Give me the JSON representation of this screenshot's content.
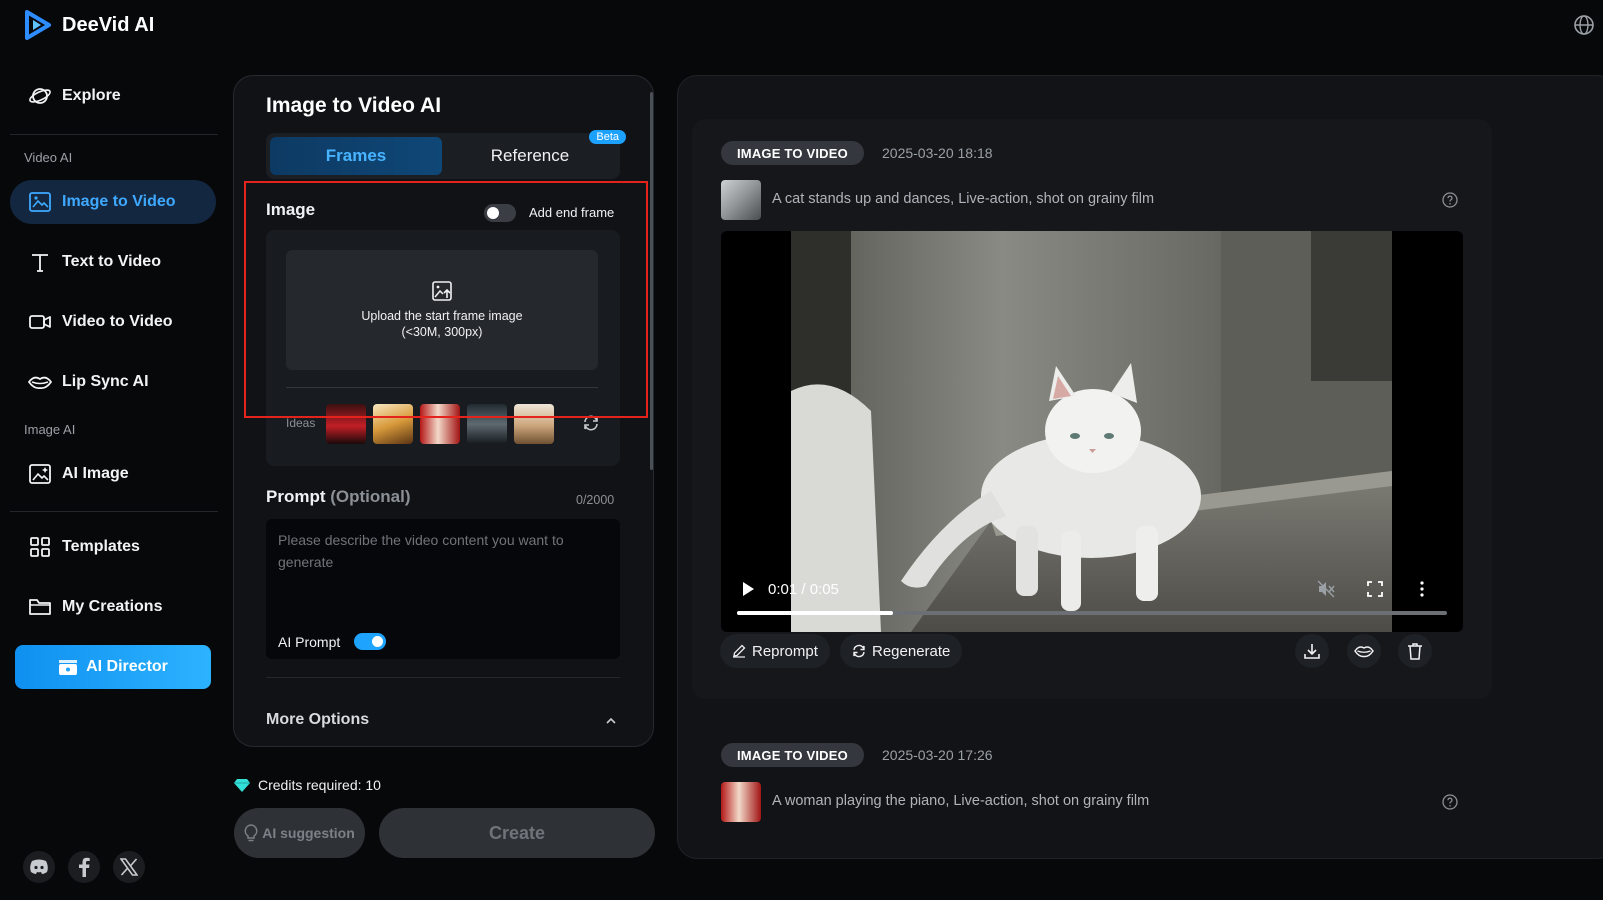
{
  "brand": {
    "name": "DeeVid AI"
  },
  "nav": {
    "explore": "Explore",
    "section_video": "Video AI",
    "image_to_video": "Image to Video",
    "text_to_video": "Text to Video",
    "video_to_video": "Video to Video",
    "lip_sync": "Lip Sync AI",
    "section_image": "Image AI",
    "ai_image": "AI Image",
    "templates": "Templates",
    "my_creations": "My Creations",
    "ai_director": "AI Director"
  },
  "form": {
    "title": "Image to Video AI",
    "tabs": {
      "frames": "Frames",
      "reference": "Reference",
      "beta": "Beta"
    },
    "image_label": "Image",
    "end_frame_label": "Add end frame",
    "upload_line1": "Upload the start frame image",
    "upload_line2": "(<30M, 300px)",
    "ideas_label": "Ideas",
    "prompt_label": "Prompt",
    "prompt_optional": "(Optional)",
    "prompt_count": "0/2000",
    "prompt_placeholder": "Please describe the video content you want to generate",
    "ai_prompt_label": "AI Prompt",
    "more_options": "More Options",
    "credits": "Credits required: 10",
    "suggestion_button": "AI suggestion",
    "create_button": "Create"
  },
  "results": {
    "items": [
      {
        "badge": "IMAGE TO VIDEO",
        "timestamp": "2025-03-20 18:18",
        "prompt": "A cat stands up and dances, Live-action, shot on grainy film",
        "time": "0:01 / 0:05",
        "progress": 0.22
      },
      {
        "badge": "IMAGE TO VIDEO",
        "timestamp": "2025-03-20 17:26",
        "prompt": "A woman playing the piano, Live-action, shot on grainy film"
      }
    ],
    "actions": {
      "reprompt": "Reprompt",
      "regenerate": "Regenerate"
    }
  },
  "colors": {
    "accent": "#1ea4ff",
    "highlight": "#e5231d",
    "active_nav_bg": "#132840"
  }
}
